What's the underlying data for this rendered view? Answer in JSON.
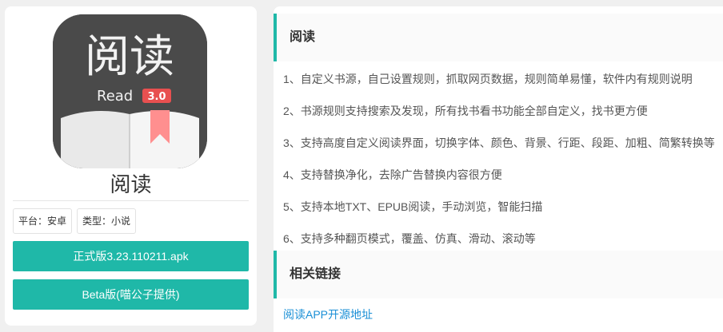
{
  "app": {
    "icon_title": "阅读",
    "icon_subtitle": "Read",
    "icon_version": "3.0",
    "name": "阅读",
    "tags": [
      "平台：安卓",
      "类型：小说"
    ],
    "buttons": {
      "stable": "正式版3.23.110211.apk",
      "beta": "Beta版(喵公子提供)"
    }
  },
  "section1": {
    "title": "阅读",
    "features": [
      "1、自定义书源，自己设置规则，抓取网页数据，规则简单易懂，软件内有规则说明",
      "2、书源规则支持搜索及发现，所有找书看书功能全部自定义，找书更方便",
      "3、支持高度自定义阅读界面，切换字体、颜色、背景、行距、段距、加粗、简繁转换等",
      "4、支持替换净化，去除广告替换内容很方便",
      "5、支持本地TXT、EPUB阅读，手动浏览，智能扫描",
      "6、支持多种翻页模式，覆盖、仿真、滑动、滚动等"
    ]
  },
  "section2": {
    "title": "相关链接",
    "link": "阅读APP开源地址"
  },
  "colors": {
    "accent": "#1fb8a8",
    "link": "#1a8fd6",
    "icon_bg": "#4a4a4a",
    "badge": "#e85050"
  }
}
